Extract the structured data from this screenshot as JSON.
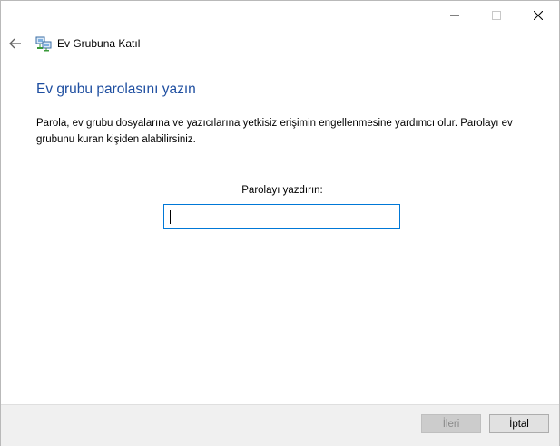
{
  "window": {
    "nav_title": "Ev Grubuna Katıl",
    "icons": {
      "back": "arrow-left-icon",
      "app": "homegroup-network-icon",
      "minimize": "minimize-icon",
      "maximize": "maximize-icon",
      "close": "close-icon"
    }
  },
  "main": {
    "heading": "Ev grubu parolasını yazın",
    "description": "Parola, ev grubu dosyalarına ve yazıcılarına yetkisiz erişimin engellenmesine yardımcı olur. Parolayı ev grubunu kuran kişiden alabilirsiniz.",
    "password_label": "Parolayı yazdırın:",
    "password_value": ""
  },
  "footer": {
    "next_label": "İleri",
    "cancel_label": "İptal"
  },
  "colors": {
    "heading": "#1e4ea0",
    "input_border": "#0078d7",
    "footer_bg": "#f0f0f0"
  }
}
